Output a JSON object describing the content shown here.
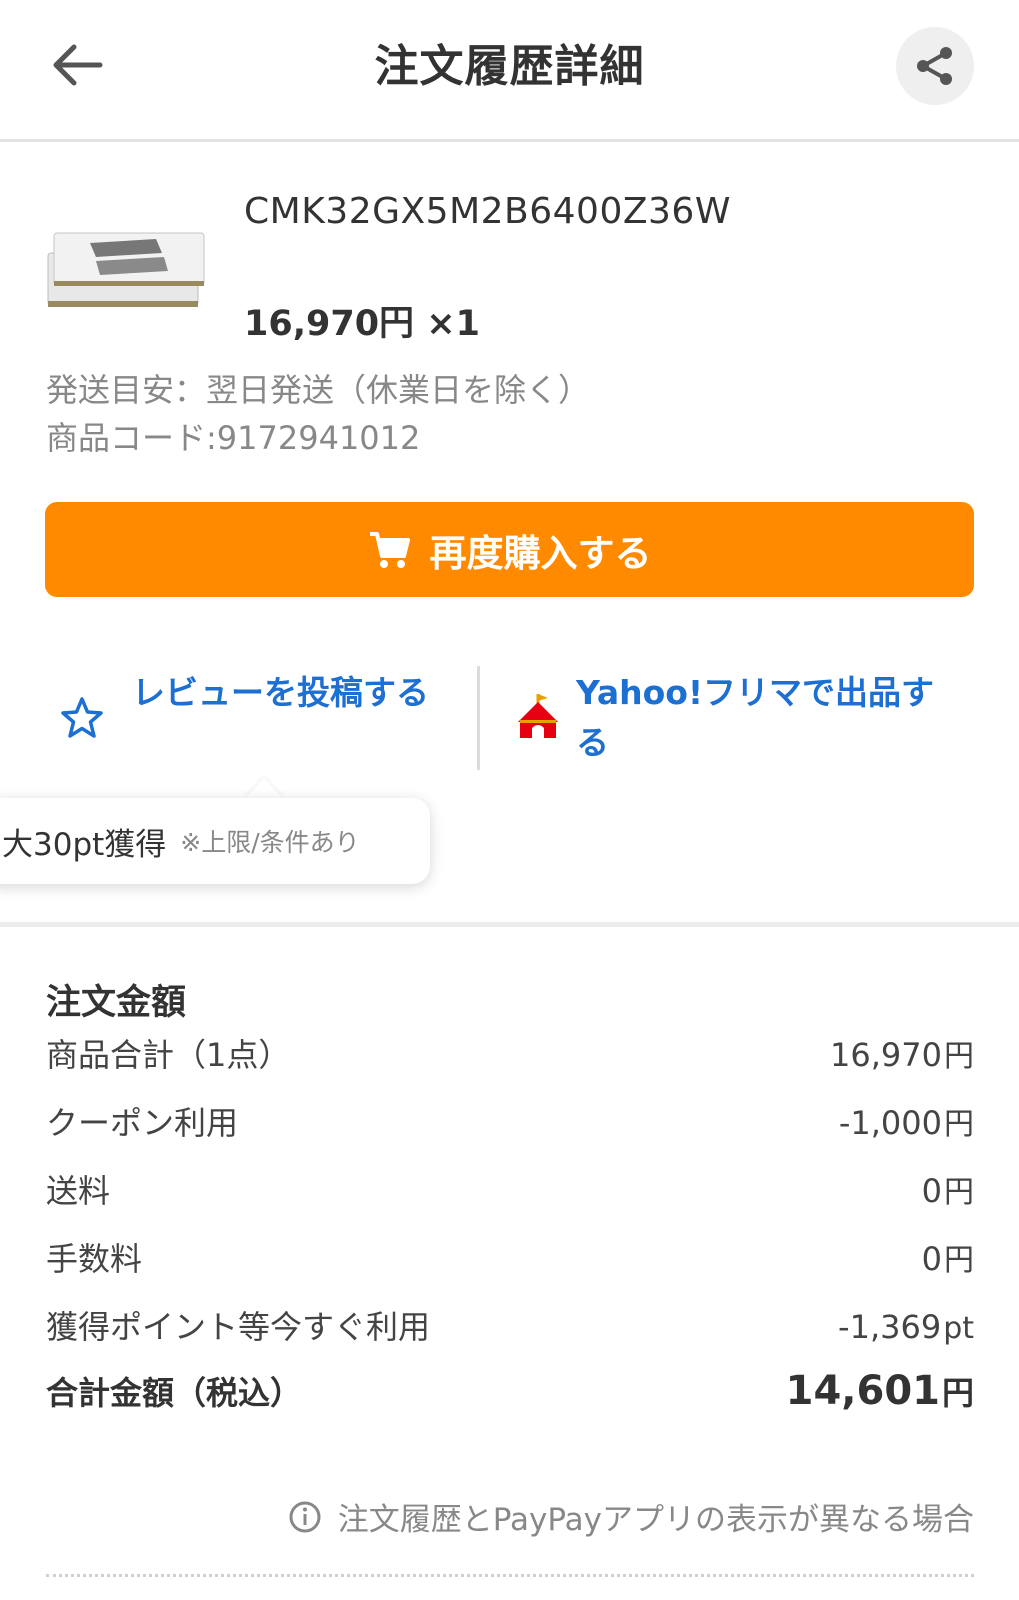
{
  "header": {
    "title": "注文履歴詳細",
    "back_icon": "arrow-left-icon",
    "share_icon": "share-icon"
  },
  "product": {
    "name": "CMK32GX5M2B6400Z36W",
    "price": "16,970円 ×1",
    "ship_info": "発送目安：翌日発送（休業日を除く）",
    "code": "商品コード:9172941012",
    "image_text": "VENGEANCE"
  },
  "rebuy": {
    "label": "再度購入する",
    "icon": "cart-icon"
  },
  "actions": {
    "review_label": "レビューを投稿する",
    "flea_label": "Yahoo!フリマで出品する"
  },
  "tooltip": {
    "main": "大30pt獲得",
    "note": "※上限/条件あり"
  },
  "summary": {
    "title": "注文金額",
    "rows": [
      {
        "label": "商品合計（1点）",
        "amount": "16,970",
        "unit": "円"
      },
      {
        "label": "クーポン利用",
        "amount": "-1,000",
        "unit": "円"
      },
      {
        "label": "送料",
        "amount": "0",
        "unit": "円"
      },
      {
        "label": "手数料",
        "amount": "0",
        "unit": "円"
      },
      {
        "label": "獲得ポイント等今すぐ利用",
        "amount": "-1,369",
        "unit": "pt"
      }
    ],
    "total": {
      "label": "合計金額（税込）",
      "amount": "14,601",
      "unit": "円"
    }
  },
  "info_link": "注文履歴とPayPayアプリの表示が異なる場合",
  "colors": {
    "accent": "#ff8a00",
    "link": "#1d6fd1",
    "flea_red": "#e60012"
  }
}
